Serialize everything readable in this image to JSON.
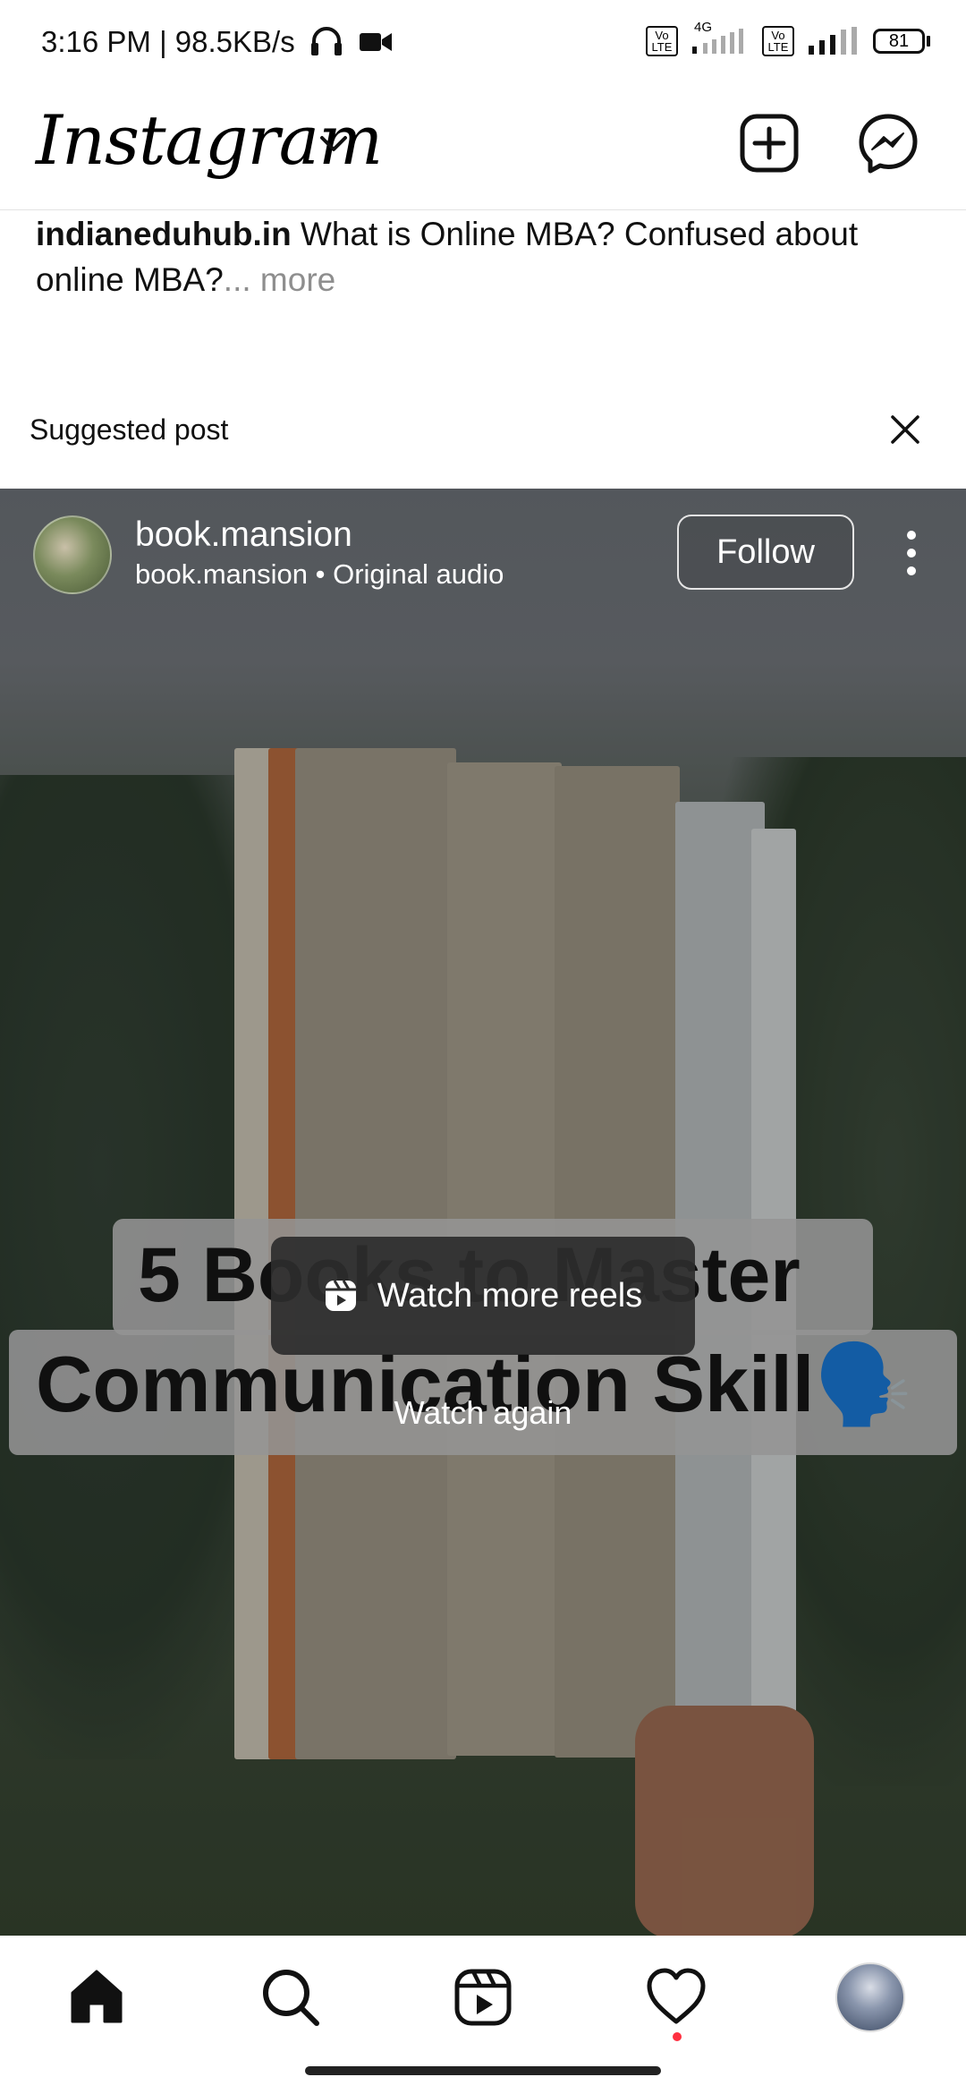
{
  "status_bar": {
    "time_speed": "3:16 PM | 98.5KB/s",
    "network": "4G",
    "volte1": "Vo LTE",
    "volte2": "Vo LTE",
    "battery": "81"
  },
  "header": {
    "app_name": "Instagram",
    "icons": [
      "chevron-down-icon",
      "new-post-icon",
      "messenger-icon"
    ]
  },
  "caption": {
    "username": "indianeduhub.in",
    "text": " What is Online MBA? Confused about online MBA?",
    "ellipsis": "...",
    "more_label": " more"
  },
  "suggested": {
    "label": "Suggested post"
  },
  "post": {
    "username": "book.mansion",
    "subline": "book.mansion • Original audio",
    "follow_label": "Follow",
    "overlay_title_line1": "5 Books to Master",
    "overlay_title_line2": "Communication Skill🗣️",
    "watch_more_label": "Watch more reels",
    "watch_again_label": "Watch again"
  },
  "bottom_nav": {
    "items": [
      "home-icon",
      "search-icon",
      "reels-icon",
      "heart-icon",
      "profile-avatar"
    ]
  },
  "colors": {
    "notification_dot": "#ff3040",
    "follow_border": "#e5e5e5"
  }
}
